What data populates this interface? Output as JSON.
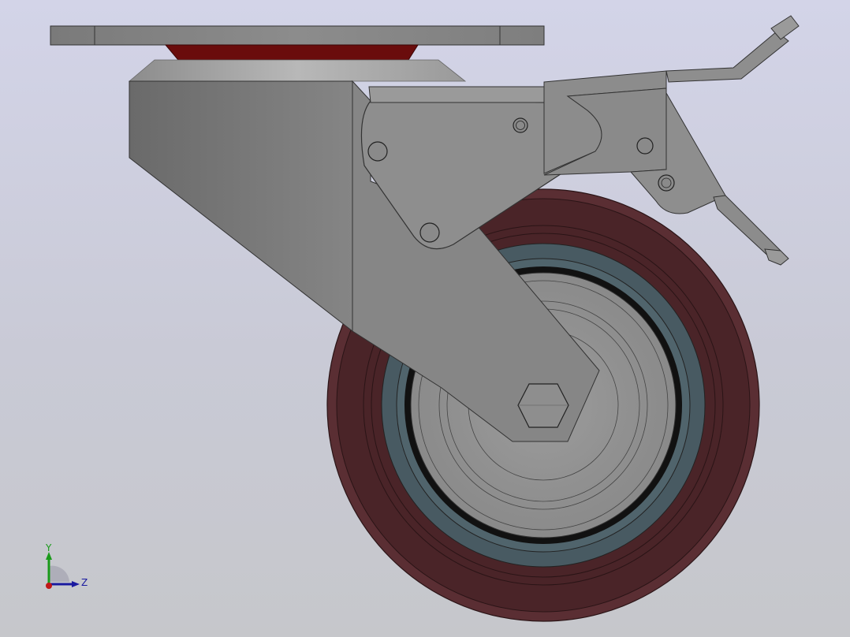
{
  "view": {
    "background_top": "#d3d4e8",
    "background_bottom": "#c6c7cb"
  },
  "model": {
    "parts": [
      "top-plate",
      "swivel-bearing",
      "fork",
      "wheel",
      "tire",
      "hub",
      "axle-nut",
      "brake-pedal",
      "brake-plate",
      "brake-lever"
    ],
    "colors": {
      "metal": "#8a8a8a",
      "metal_dark": "#6e6e6e",
      "tire": "#4a2428",
      "tire_edge": "#5a2e33",
      "rim_band": "#485a62",
      "hub": "#9a9a9a",
      "bearing": "#6a0c0c"
    }
  },
  "triad": {
    "y_label": "Y",
    "z_label": "Z",
    "y_color": "#1a9a1a",
    "z_color": "#1a1aa0",
    "x_color": "#c01818"
  }
}
